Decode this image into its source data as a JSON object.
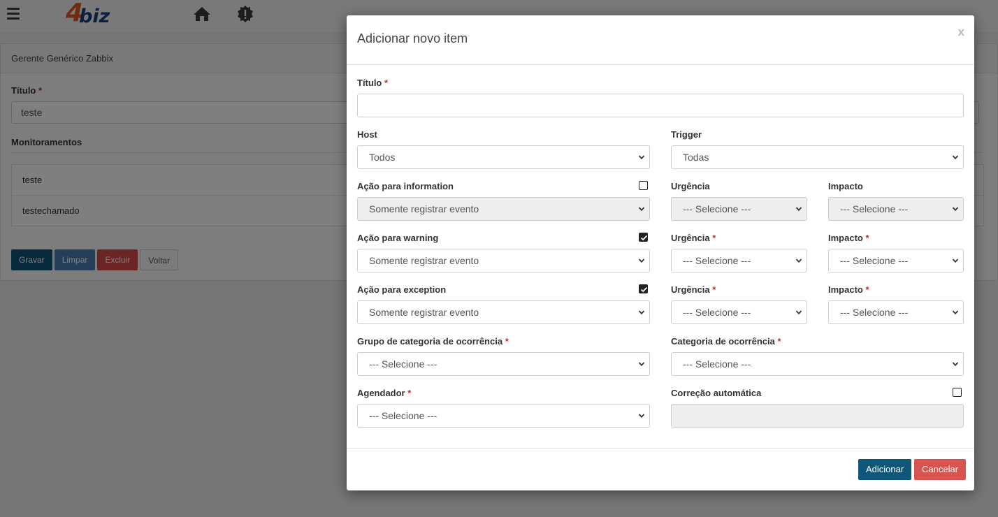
{
  "app": {
    "logo_number": "4",
    "logo_text": "biz",
    "brand_colors": {
      "orange": "#e2571c",
      "blue": "#1b3f7d"
    }
  },
  "page": {
    "panel_title": "Gerente Genérico Zabbix",
    "title_label": "Título",
    "required_mark": "*",
    "title_value": "teste",
    "monitoramentos_label": "Monitoramentos",
    "monitoramentos": [
      "teste",
      "testechamado"
    ],
    "buttons": {
      "gravar": "Gravar",
      "limpar": "Limpar",
      "excluir": "Excluir",
      "voltar": "Voltar"
    }
  },
  "modal": {
    "title": "Adicionar novo item",
    "close": "x",
    "required_mark": "*",
    "fields": {
      "titulo": {
        "label": "Título",
        "value": ""
      },
      "host": {
        "label": "Host",
        "value": "Todos"
      },
      "trigger": {
        "label": "Trigger",
        "value": "Todas"
      },
      "acao_information": {
        "label": "Ação para information",
        "value": "Somente registrar evento",
        "checked": false
      },
      "urgencia_information": {
        "label": "Urgência",
        "value": "--- Selecione ---"
      },
      "impacto_information": {
        "label": "Impacto",
        "value": "--- Selecione ---"
      },
      "acao_warning": {
        "label": "Ação para warning",
        "value": "Somente registrar evento",
        "checked": true
      },
      "urgencia_warning": {
        "label": "Urgência",
        "value": "--- Selecione ---"
      },
      "impacto_warning": {
        "label": "Impacto",
        "value": "--- Selecione ---"
      },
      "acao_exception": {
        "label": "Ação para exception",
        "value": "Somente registrar evento",
        "checked": true
      },
      "urgencia_exception": {
        "label": "Urgência",
        "value": "--- Selecione ---"
      },
      "impacto_exception": {
        "label": "Impacto",
        "value": "--- Selecione ---"
      },
      "grupo_categoria": {
        "label": "Grupo de categoria de ocorrência",
        "value": "--- Selecione ---"
      },
      "categoria": {
        "label": "Categoria de ocorrência",
        "value": "--- Selecione ---"
      },
      "agendador": {
        "label": "Agendador",
        "value": "--- Selecione ---"
      },
      "correcao": {
        "label": "Correção automática",
        "value": "",
        "checked": false
      }
    },
    "buttons": {
      "adicionar": "Adicionar",
      "cancelar": "Cancelar"
    }
  },
  "icons": [
    "menu-icon",
    "home-icon",
    "alert-icon",
    "chevron-down-icon",
    "checkmark-icon"
  ],
  "colors": {
    "primary": "#0f5678",
    "danger": "#d9534f",
    "required": "#b33333"
  }
}
